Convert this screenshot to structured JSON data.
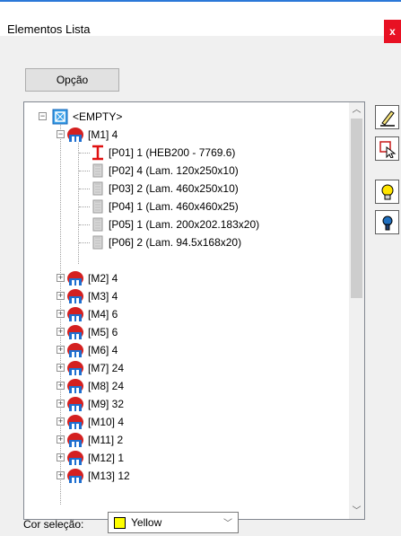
{
  "window": {
    "title": "Elementos Lista",
    "close_label": "x"
  },
  "toolbar": {
    "option_label": "Opção"
  },
  "tree": {
    "root": {
      "label": "<EMPTY>",
      "expander": "−"
    },
    "m1": {
      "label": "[M1] 4",
      "expander": "−"
    },
    "parts": [
      {
        "label": "[P01] 1 (HEB200 - 7769.6)",
        "type": "beam"
      },
      {
        "label": "[P02] 4 (Lam. 120x250x10)",
        "type": "plate"
      },
      {
        "label": "[P03] 2 (Lam. 460x250x10)",
        "type": "plate"
      },
      {
        "label": "[P04] 1 (Lam. 460x460x25)",
        "type": "plate"
      },
      {
        "label": "[P05] 1 (Lam. 200x202.183x20)",
        "type": "plate"
      },
      {
        "label": "[P06] 2 (Lam. 94.5x168x20)",
        "type": "plate"
      }
    ],
    "assemblies": [
      {
        "label": "[M2] 4",
        "expander": "+"
      },
      {
        "label": "[M3] 4",
        "expander": "+"
      },
      {
        "label": "[M4] 6",
        "expander": "+"
      },
      {
        "label": "[M5] 6",
        "expander": "+"
      },
      {
        "label": "[M6] 4",
        "expander": "+"
      },
      {
        "label": "[M7] 24",
        "expander": "+"
      },
      {
        "label": "[M8] 24",
        "expander": "+"
      },
      {
        "label": "[M9] 32",
        "expander": "+"
      },
      {
        "label": "[M10] 4",
        "expander": "+"
      },
      {
        "label": "[M11] 2",
        "expander": "+"
      },
      {
        "label": "[M12] 1",
        "expander": "+"
      },
      {
        "label": "[M13] 12",
        "expander": "+"
      }
    ]
  },
  "side_buttons": [
    {
      "icon": "pencil-icon"
    },
    {
      "icon": "select-cursor-icon"
    },
    {
      "icon": "lightbulb-on-icon"
    },
    {
      "icon": "lightbulb-off-icon"
    }
  ],
  "footer": {
    "selection_color_label": "Cor seleção:",
    "selection_color_value": "Yellow",
    "selection_color_hex": "#ffff00"
  }
}
